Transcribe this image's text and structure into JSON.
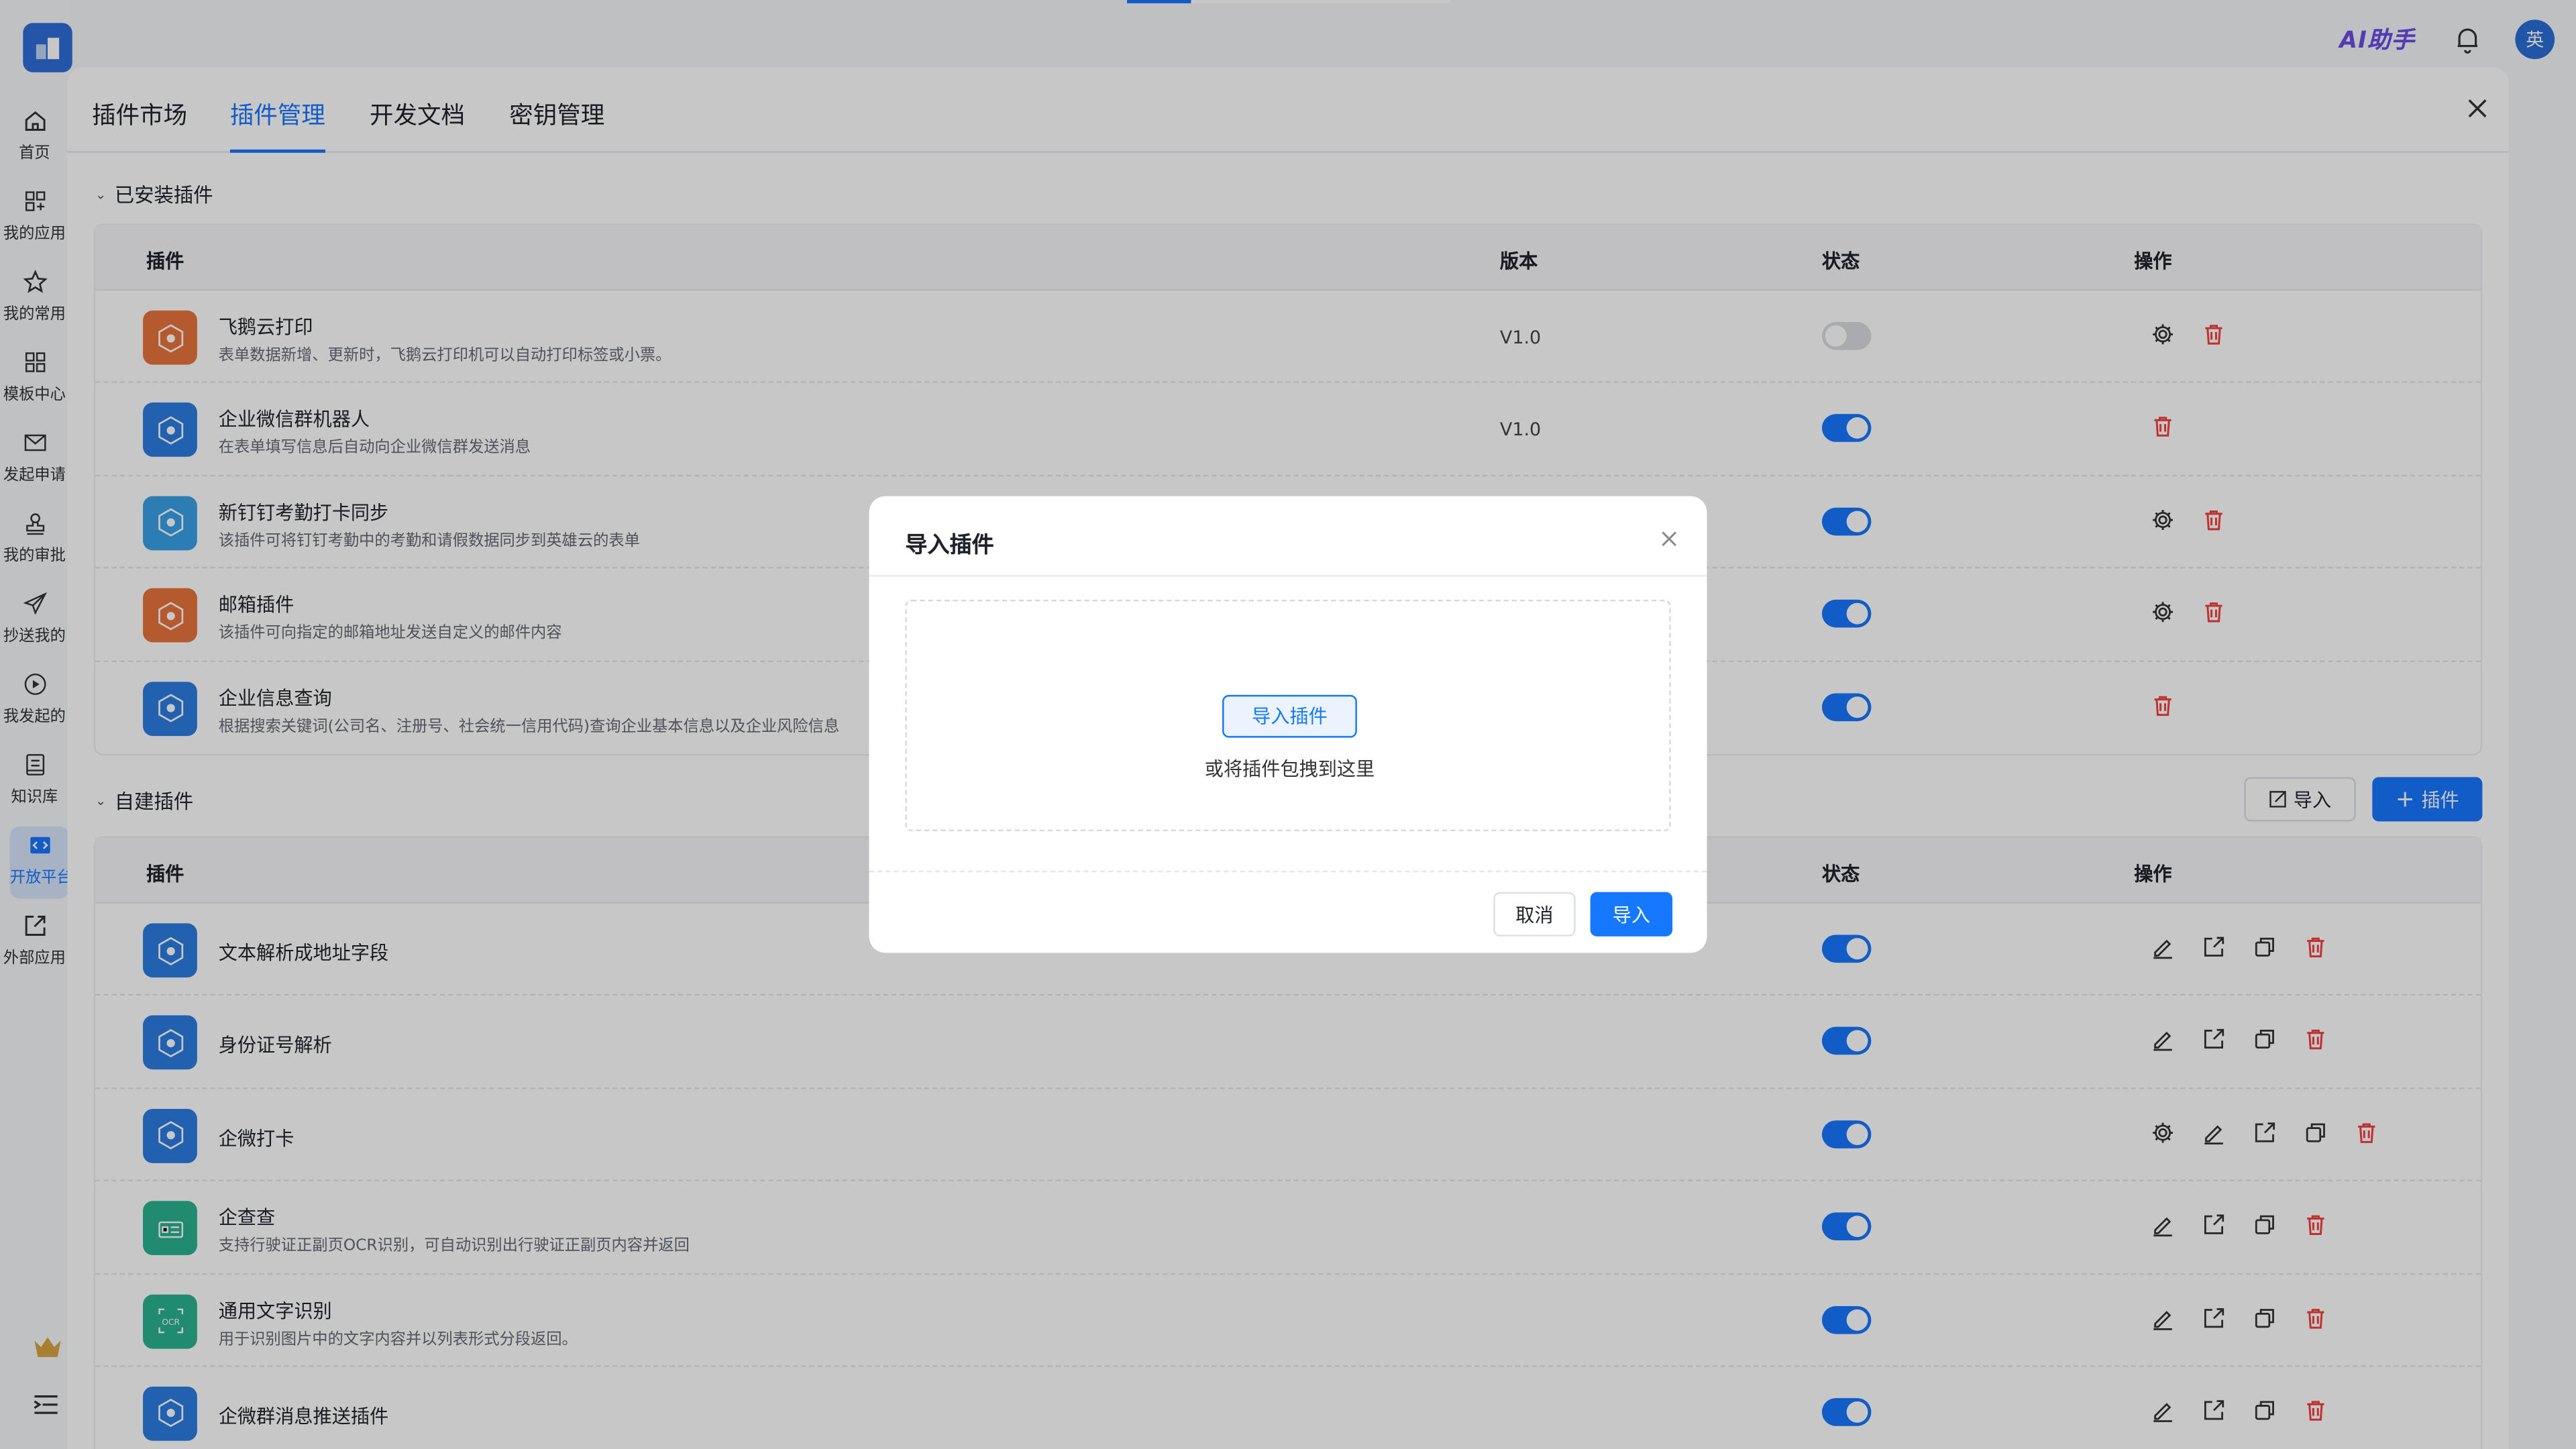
{
  "colors": {
    "accent": "#1677ff",
    "danger": "#f53f3f",
    "ai": "#6b4de6"
  },
  "topbar": {
    "ai_label": "AI助手",
    "avatar_text": "英"
  },
  "rail": [
    {
      "label": "首页",
      "icon": "home-icon"
    },
    {
      "label": "我的应用",
      "icon": "grid-icon"
    },
    {
      "label": "我的常用",
      "icon": "star-icon"
    },
    {
      "label": "模板中心",
      "icon": "template-icon"
    },
    {
      "label": "发起申请",
      "icon": "mail-icon"
    },
    {
      "label": "我的审批",
      "icon": "stamp-icon"
    },
    {
      "label": "抄送我的",
      "icon": "send-icon"
    },
    {
      "label": "我发起的",
      "icon": "play-icon"
    },
    {
      "label": "知识库",
      "icon": "book-icon"
    },
    {
      "label": "开放平台",
      "icon": "code-icon"
    },
    {
      "label": "外部应用",
      "icon": "external-icon"
    }
  ],
  "tabs": [
    "插件市场",
    "插件管理",
    "开发文档",
    "密钥管理"
  ],
  "installed": {
    "title": "已安装插件",
    "headers": {
      "plugin": "插件",
      "version": "版本",
      "status": "状态",
      "ops": "操作"
    },
    "rows": [
      {
        "name": "飞鹅云打印",
        "desc": "表单数据新增、更新时，飞鹅云打印机可以自动打印标签或小票。",
        "version": "V1.0",
        "on": false,
        "color": "#e8743b",
        "gear": true
      },
      {
        "name": "企业微信群机器人",
        "desc": "在表单填写信息后自动向企业微信群发送消息",
        "version": "V1.0",
        "on": true,
        "color": "#2b7de0",
        "gear": false
      },
      {
        "name": "新钉钉考勤打卡同步",
        "desc": "该插件可将钉钉考勤中的考勤和请假数据同步到英雄云的表单",
        "version": "",
        "on": true,
        "color": "#3aa0e8",
        "gear": true
      },
      {
        "name": "邮箱插件",
        "desc": "该插件可向指定的邮箱地址发送自定义的邮件内容",
        "version": "",
        "on": true,
        "color": "#e8743b",
        "gear": true
      },
      {
        "name": "企业信息查询",
        "desc": "根据搜索关键词(公司名、注册号、社会统一信用代码)查询企业基本信息以及企业风险信息",
        "version": "",
        "on": true,
        "color": "#2b7de0",
        "gear": false
      }
    ]
  },
  "custom": {
    "title": "自建插件",
    "import_label": "导入",
    "add_label": "插件",
    "headers": {
      "plugin": "插件",
      "status": "状态",
      "ops": "操作"
    },
    "rows": [
      {
        "name": "文本解析成地址字段",
        "desc": "",
        "on": true,
        "color": "#2b7de0",
        "gear": false
      },
      {
        "name": "身份证号解析",
        "desc": "",
        "on": true,
        "color": "#2b7de0",
        "gear": false
      },
      {
        "name": "企微打卡",
        "desc": "",
        "on": true,
        "color": "#2b7de0",
        "gear": true
      },
      {
        "name": "企查查",
        "desc": "支持行驶证正副页OCR识别，可自动识别出行驶证正副页内容并返回",
        "on": true,
        "color": "#29b38f",
        "gear": false
      },
      {
        "name": "通用文字识别",
        "desc": "用于识别图片中的文字内容并以列表形式分段返回。",
        "on": true,
        "color": "#29b38f",
        "gear": false
      },
      {
        "name": "企微群消息推送插件",
        "desc": "",
        "on": true,
        "color": "#2b7de0",
        "gear": false
      }
    ]
  },
  "modal": {
    "title": "导入插件",
    "upload_btn": "导入插件",
    "hint": "或将插件包拽到这里",
    "cancel": "取消",
    "ok": "导入"
  }
}
